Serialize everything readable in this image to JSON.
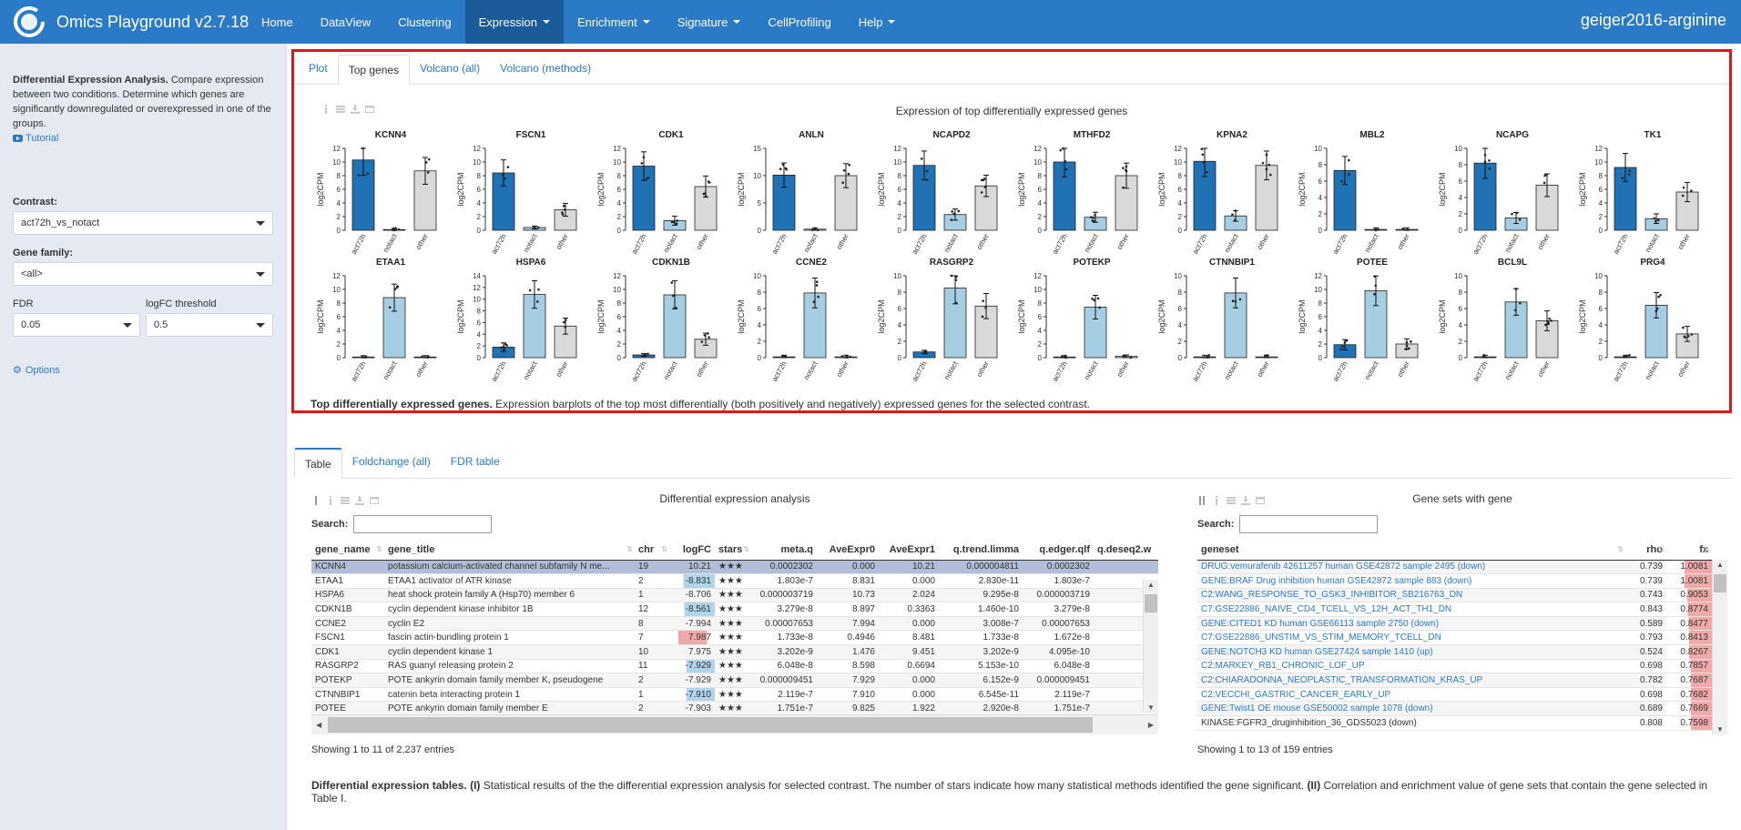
{
  "app": {
    "title": "Omics Playground v2.7.18",
    "dataset": "geiger2016-arginine"
  },
  "nav": [
    {
      "label": "Home",
      "dropdown": false,
      "active": false
    },
    {
      "label": "DataView",
      "dropdown": false,
      "active": false
    },
    {
      "label": "Clustering",
      "dropdown": false,
      "active": false
    },
    {
      "label": "Expression",
      "dropdown": true,
      "active": true
    },
    {
      "label": "Enrichment",
      "dropdown": true,
      "active": false
    },
    {
      "label": "Signature",
      "dropdown": true,
      "active": false
    },
    {
      "label": "CellProfiling",
      "dropdown": false,
      "active": false
    },
    {
      "label": "Help",
      "dropdown": true,
      "active": false
    }
  ],
  "sidebar": {
    "desc_bold": "Differential Expression Analysis.",
    "desc_rest": " Compare expression between two conditions. Determine which genes are significantly downregulated or overexpressed in one of the groups.",
    "tutorial": "Tutorial",
    "contrast_label": "Contrast:",
    "contrast_value": "act72h_vs_notact",
    "gene_family_label": "Gene family:",
    "gene_family_value": "<all>",
    "fdr_label": "FDR",
    "fdr_value": "0.05",
    "logfc_label": "logFC threshold",
    "logfc_value": "0.5",
    "options": "Options"
  },
  "upper_tabs": [
    {
      "label": "Plot",
      "active": false
    },
    {
      "label": "Top genes",
      "active": true
    },
    {
      "label": "Volcano (all)",
      "active": false
    },
    {
      "label": "Volcano (methods)",
      "active": false
    }
  ],
  "plot_title": "Expression of top differentially expressed genes",
  "caption_bold": "Top differentially expressed genes.",
  "caption_rest": " Expression barplots of the top most differentially (both positively and negatively) expressed genes for the selected contrast.",
  "chart_data": {
    "type": "bar",
    "ylabel": "log2CPM",
    "categories": [
      "act72h",
      "notact",
      "other"
    ],
    "colors": {
      "act72h": "#2171b5",
      "notact": "#a6cee3",
      "other": "#d9d9d9"
    },
    "panels": [
      {
        "gene": "KCNN4",
        "ymax": 12,
        "ticks": [
          0,
          2,
          4,
          6,
          8,
          10,
          12
        ],
        "values": [
          10.3,
          0.1,
          8.7
        ]
      },
      {
        "gene": "FSCN1",
        "ymax": 12,
        "ticks": [
          0,
          2,
          4,
          6,
          8,
          10,
          12
        ],
        "values": [
          8.4,
          0.4,
          3.0
        ]
      },
      {
        "gene": "CDK1",
        "ymax": 12,
        "ticks": [
          0,
          2,
          4,
          6,
          8,
          10,
          12
        ],
        "values": [
          9.4,
          1.4,
          6.4
        ]
      },
      {
        "gene": "ANLN",
        "ymax": 15,
        "ticks": [
          0,
          5,
          10,
          15
        ],
        "values": [
          10.1,
          0.2,
          10.0
        ]
      },
      {
        "gene": "NCAPD2",
        "ymax": 12,
        "ticks": [
          0,
          2,
          4,
          6,
          8,
          10,
          12
        ],
        "values": [
          9.5,
          2.3,
          6.5
        ]
      },
      {
        "gene": "MTHFD2",
        "ymax": 12,
        "ticks": [
          0,
          2,
          4,
          6,
          8,
          10,
          12
        ],
        "values": [
          10.0,
          1.9,
          8.0
        ]
      },
      {
        "gene": "KPNA2",
        "ymax": 12,
        "ticks": [
          0,
          2,
          4,
          6,
          8,
          10,
          12
        ],
        "values": [
          10.1,
          2.1,
          9.5
        ]
      },
      {
        "gene": "MBL2",
        "ymax": 10,
        "ticks": [
          0,
          2,
          4,
          6,
          8,
          10
        ],
        "values": [
          7.3,
          0.1,
          0.1
        ]
      },
      {
        "gene": "NCAPG",
        "ymax": 10,
        "ticks": [
          0,
          2,
          4,
          6,
          8,
          10
        ],
        "values": [
          8.2,
          1.5,
          5.5
        ]
      },
      {
        "gene": "TK1",
        "ymax": 12,
        "ticks": [
          0,
          2,
          4,
          6,
          8,
          10,
          12
        ],
        "values": [
          9.2,
          1.7,
          5.6
        ]
      },
      {
        "gene": "ETAA1",
        "ymax": 12,
        "ticks": [
          0,
          2,
          4,
          6,
          8,
          10,
          12
        ],
        "values": [
          0.1,
          8.8,
          0.1
        ]
      },
      {
        "gene": "HSPA6",
        "ymax": 14,
        "ticks": [
          0,
          2,
          4,
          6,
          8,
          10,
          12,
          14
        ],
        "values": [
          1.8,
          10.8,
          5.4
        ]
      },
      {
        "gene": "CDKN1B",
        "ymax": 12,
        "ticks": [
          0,
          2,
          4,
          6,
          8,
          10,
          12
        ],
        "values": [
          0.4,
          9.2,
          2.7
        ]
      },
      {
        "gene": "CCNE2",
        "ymax": 10,
        "ticks": [
          0,
          2,
          4,
          6,
          8,
          10
        ],
        "values": [
          0.1,
          7.9,
          0.1
        ]
      },
      {
        "gene": "RASGRP2",
        "ymax": 10,
        "ticks": [
          0,
          2,
          4,
          6,
          8,
          10
        ],
        "values": [
          0.7,
          8.5,
          6.3
        ]
      },
      {
        "gene": "POTEKP",
        "ymax": 12,
        "ticks": [
          0,
          2,
          4,
          6,
          8,
          10,
          12
        ],
        "values": [
          0.1,
          7.4,
          0.2
        ]
      },
      {
        "gene": "CTNNBIP1",
        "ymax": 10,
        "ticks": [
          0,
          2,
          4,
          6,
          8,
          10
        ],
        "values": [
          0.1,
          7.9,
          0.1
        ]
      },
      {
        "gene": "POTEE",
        "ymax": 12,
        "ticks": [
          0,
          2,
          4,
          6,
          8,
          10,
          12
        ],
        "values": [
          1.9,
          9.8,
          2.0
        ]
      },
      {
        "gene": "BCL9L",
        "ymax": 10,
        "ticks": [
          0,
          2,
          4,
          6,
          8,
          10
        ],
        "values": [
          0.1,
          6.8,
          4.5
        ]
      },
      {
        "gene": "PRG4",
        "ymax": 10,
        "ticks": [
          0,
          2,
          4,
          6,
          8,
          10
        ],
        "values": [
          0.1,
          6.4,
          2.9
        ]
      }
    ]
  },
  "lower_tabs": [
    {
      "label": "Table",
      "active": true
    },
    {
      "label": "Foldchange (all)",
      "active": false
    },
    {
      "label": "FDR table",
      "active": false
    }
  ],
  "de_table": {
    "title": "Differential expression analysis",
    "search_label": "Search:",
    "columns": [
      "gene_name",
      "gene_title",
      "chr",
      "logFC",
      "stars",
      "meta.q",
      "AveExpr0",
      "AveExpr1",
      "q.trend.limma",
      "q.edger.qlf",
      "q.deseq2.w"
    ],
    "rows": [
      [
        "KCNN4",
        "potassium calcium-activated channel subfamily N me...",
        "19",
        "10.21",
        "★★★",
        "0.0002302",
        "0.000",
        "10.21",
        "0.000004811",
        "0.0002302",
        ""
      ],
      [
        "ETAA1",
        "ETAA1 activator of ATR kinase",
        "2",
        "-8.831",
        "★★★",
        "1.803e-7",
        "8.831",
        "0.000",
        "2.830e-11",
        "1.803e-7",
        ""
      ],
      [
        "HSPA6",
        "heat shock protein family A (Hsp70) member 6",
        "1",
        "-8.706",
        "★★★",
        "0.000003719",
        "10.73",
        "2.024",
        "9.295e-8",
        "0.000003719",
        ""
      ],
      [
        "CDKN1B",
        "cyclin dependent kinase inhibitor 1B",
        "12",
        "-8.561",
        "★★★",
        "3.279e-8",
        "8.897",
        "0.3363",
        "1.460e-10",
        "3.279e-8",
        ""
      ],
      [
        "CCNE2",
        "cyclin E2",
        "8",
        "-7.994",
        "★★★",
        "0.00007653",
        "7.994",
        "0.000",
        "3.008e-7",
        "0.00007653",
        ""
      ],
      [
        "FSCN1",
        "fascin actin-bundling protein 1",
        "7",
        "7.987",
        "★★★",
        "1.733e-8",
        "0.4946",
        "8.481",
        "1.733e-8",
        "1.672e-8",
        ""
      ],
      [
        "CDK1",
        "cyclin dependent kinase 1",
        "10",
        "7.975",
        "★★★",
        "3.202e-9",
        "1.476",
        "9.451",
        "3.202e-9",
        "4.095e-10",
        ""
      ],
      [
        "RASGRP2",
        "RAS guanyl releasing protein 2",
        "11",
        "-7.929",
        "★★★",
        "6.048e-8",
        "8.598",
        "0.6694",
        "5.153e-10",
        "6.048e-8",
        ""
      ],
      [
        "POTEKP",
        "POTE ankyrin domain family member K, pseudogene",
        "2",
        "-7.929",
        "★★★",
        "0.000009451",
        "7.929",
        "0.000",
        "6.152e-9",
        "0.000009451",
        ""
      ],
      [
        "CTNNBIP1",
        "catenin beta interacting protein 1",
        "1",
        "-7.910",
        "★★★",
        "2.119e-7",
        "7.910",
        "0.000",
        "6.545e-11",
        "2.119e-7",
        ""
      ],
      [
        "POTEE",
        "POTE ankyrin domain family member E",
        "2",
        "-7.903",
        "★★★",
        "1.751e-7",
        "9.825",
        "1.922",
        "2.920e-8",
        "1.751e-7",
        ""
      ]
    ],
    "info": "Showing 1 to 11 of 2,237 entries"
  },
  "gs_table": {
    "title": "Gene sets with gene",
    "search_label": "Search:",
    "columns": [
      "geneset",
      "rho",
      "fx"
    ],
    "rows": [
      [
        "DRUG:vemurafenib 42611257 human GSE42872 sample 2495 (down)",
        "0.739",
        "1.0081"
      ],
      [
        "GENE:BRAF Drug inhibition human GSE42872 sample 883 (down)",
        "0.739",
        "1.0081"
      ],
      [
        "C2:WANG_RESPONSE_TO_GSK3_INHIBITOR_SB216763_DN",
        "0.743",
        "0.9053"
      ],
      [
        "C7:GSE22886_NAIVE_CD4_TCELL_VS_12H_ACT_TH1_DN",
        "0.843",
        "0.8774"
      ],
      [
        "GENE:CITED1 KD human GSE66113 sample 2750 (down)",
        "0.589",
        "0.8477"
      ],
      [
        "C7:GSE22886_UNSTIM_VS_STIM_MEMORY_TCELL_DN",
        "0.793",
        "0.8413"
      ],
      [
        "GENE:NOTCH3 KD human GSE27424 sample 1410 (up)",
        "0.524",
        "0.8267"
      ],
      [
        "C2:MARKEY_RB1_CHRONIC_LOF_UP",
        "0.698",
        "0.7857"
      ],
      [
        "C2:CHIARADONNA_NEOPLASTIC_TRANSFORMATION_KRAS_UP",
        "0.782",
        "0.7687"
      ],
      [
        "C2:VECCHI_GASTRIC_CANCER_EARLY_UP",
        "0.698",
        "0.7682"
      ],
      [
        "GENE:Twist1 OE mouse GSE50002 sample 1078 (down)",
        "0.689",
        "0.7669"
      ],
      [
        "KINASE:FGFR3_druginhibition_36_GDS5023 (down)",
        "0.808",
        "0.7598"
      ]
    ],
    "info": "Showing 1 to 13 of 159 entries"
  },
  "bottom_caption": {
    "b1": "Differential expression tables.",
    "t1": " ",
    "b2": "(I)",
    "t2": " Statistical results of the the differential expression analysis for selected contrast. The number of stars indicate how many statistical methods identified the gene significant. ",
    "b3": "(II)",
    "t3": " Correlation and enrichment value of gene sets that contain the gene selected in Table I."
  }
}
